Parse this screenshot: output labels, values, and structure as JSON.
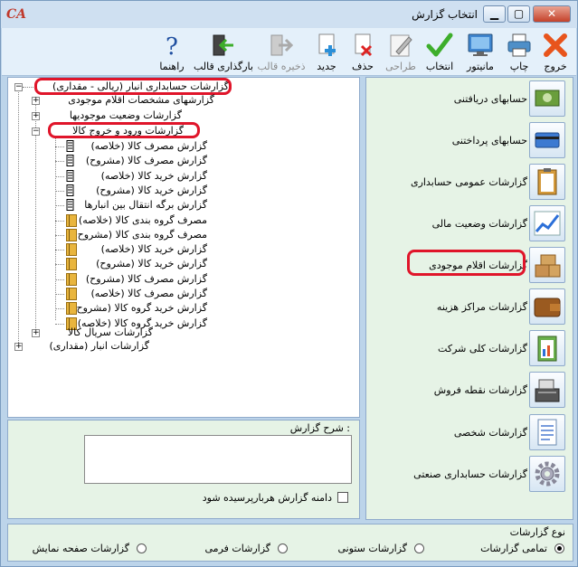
{
  "window": {
    "logo": "CA",
    "title": "انتخاب گزارش"
  },
  "toolbar": {
    "exit": "خروج",
    "print": "چاپ",
    "monitor": "مانیتور",
    "select": "انتخاب",
    "design": "طراحی",
    "delete": "حذف",
    "new": "جدید",
    "save_template": "ذخیره قالب",
    "load_template": "بارگذاری قالب",
    "help": "راهنما"
  },
  "tree": {
    "root": "گزارشات حسابداری انبار (ریالی - مقداری)",
    "spec": "گزارشهای مشخصات اقلام موجودی",
    "status": "گزارشات وضعیت موجودیها",
    "inout": "گزارشات ورود و خروج کالا",
    "children": [
      "گزارش مصرف کالا (خلاصه)",
      "گزارش مصرف کالا (مشروح)",
      "گزارش خرید کالا (خلاصه)",
      "گزارش خرید کالا (مشروح)",
      "گزارش برگه انتقال بین انبارها",
      "مصرف گروه بندی کالا (خلاصه)",
      "مصرف گروه بندی کالا (مشروح)",
      "گزارش خرید کالا (خلاصه)",
      "گزارش خرید کالا (مشروح)",
      "گزارش مصرف کالا (مشروح)",
      "گزارش مصرف کالا (خلاصه)",
      "گزارش خرید گروه کالا (مشروح)",
      "گزارش خرید گروه کالا (خلاصه)"
    ],
    "serial": "گزارشات سریال کالا",
    "qty": "گزارشات انبار (مقداری)"
  },
  "description": {
    "title": "شرح گزارش :",
    "checkbox": "دامنه گزارش هربارپرسیده شود"
  },
  "categories": [
    "حسابهای دریافتنی",
    "حسابهای پرداختنی",
    "گزارشات عمومی حسابداری",
    "گزارشات وضعیت مالی",
    "گزارشات اقلام موجودی",
    "گزارشات مراکز هزینه",
    "گزارشات کلی شرکت",
    "گزارشات نقطه فروش",
    "گزارشات شخصی",
    "گزارشات حسابداری صنعتی"
  ],
  "report_type": {
    "title": "نوع گزارشات",
    "options": [
      "تمامی گزارشات",
      "گزارشات ستونی",
      "گزارشات فرمی",
      "گزارشات صفحه نمایش"
    ],
    "selected": "تمامی گزارشات"
  },
  "colors": {
    "highlight": "#e0152a",
    "accent": "#bcd4ea"
  }
}
